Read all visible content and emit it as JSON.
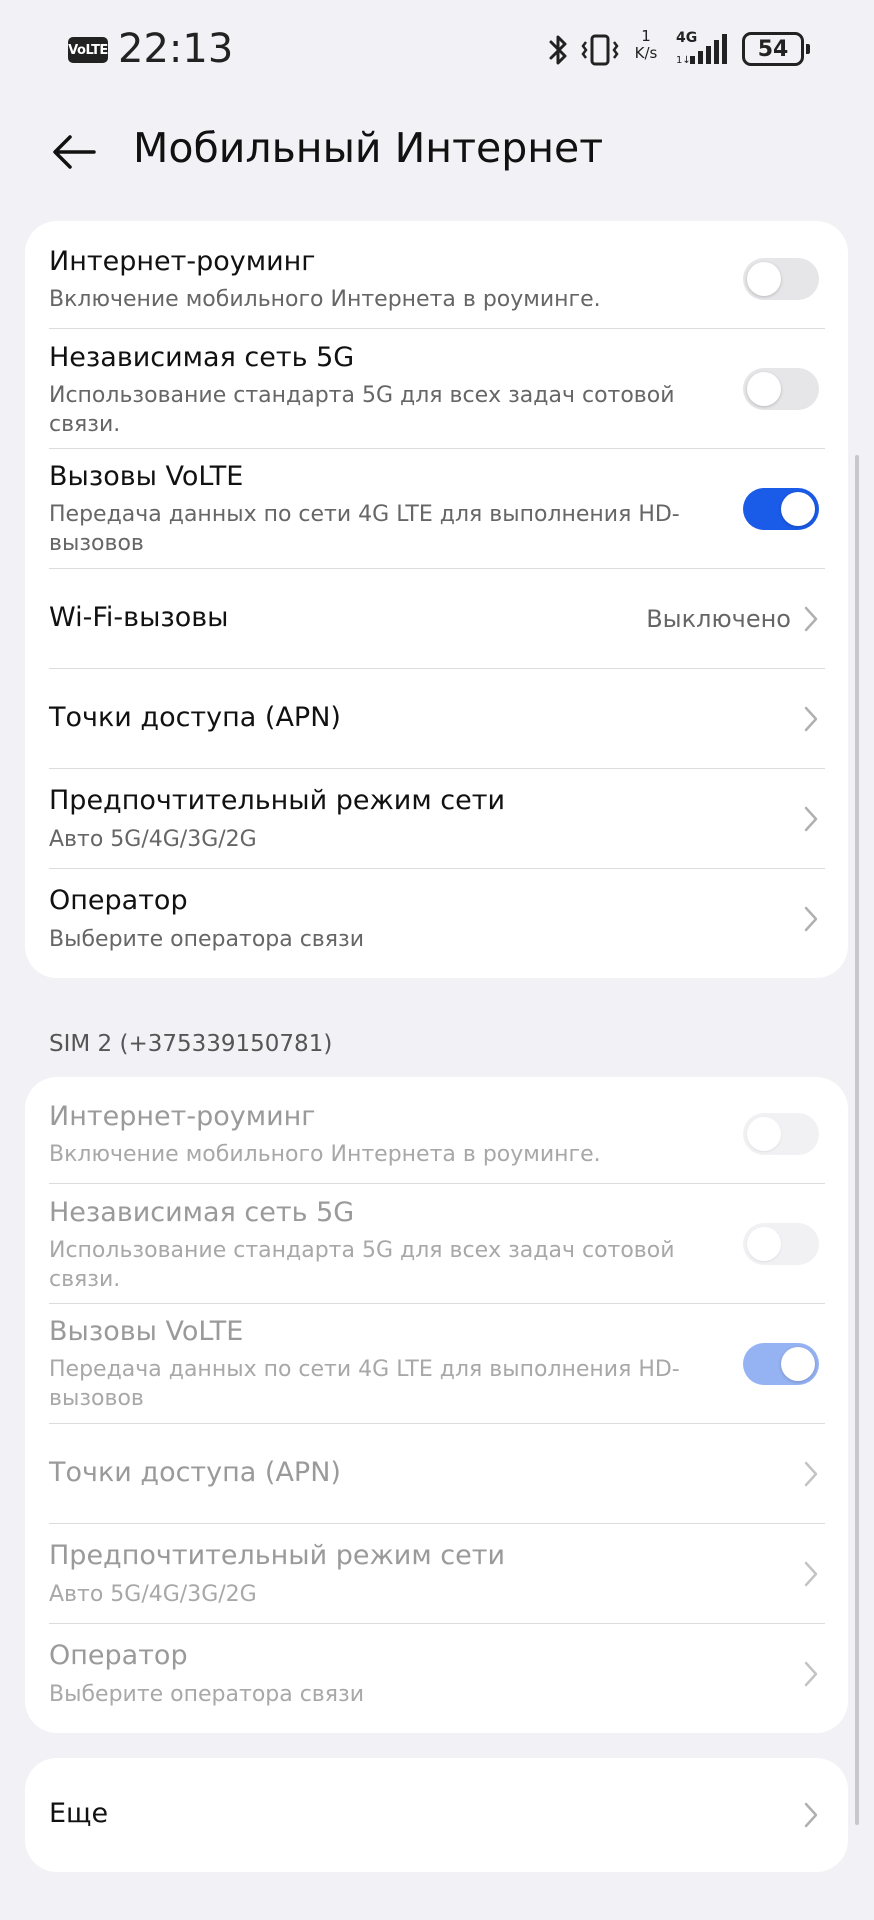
{
  "status_bar": {
    "volte": "VoLTE",
    "time": "22:13",
    "speed_value": "1",
    "speed_unit": "K/s",
    "network": "4G",
    "battery": "54"
  },
  "header": {
    "title": "Мобильный Интернет"
  },
  "sim1": {
    "roaming": {
      "title": "Интернет-роуминг",
      "subtitle": "Включение мобильного Интернета в роуминге."
    },
    "sa5g": {
      "title": "Независимая сеть 5G",
      "subtitle": "Использование стандарта 5G для всех задач сотовой связи."
    },
    "volte": {
      "title": "Вызовы VoLTE",
      "subtitle": "Передача данных по сети 4G LTE для выполнения HD-вызовов"
    },
    "wifi_calls": {
      "title": "Wi-Fi-вызовы",
      "value": "Выключено"
    },
    "apn": {
      "title": "Точки доступа (APN)"
    },
    "network_mode": {
      "title": "Предпочтительный режим сети",
      "subtitle": "Авто 5G/4G/3G/2G"
    },
    "operator": {
      "title": "Оператор",
      "subtitle": "Выберите оператора связи"
    }
  },
  "sim2": {
    "header": "SIM 2 (+375339150781)",
    "roaming": {
      "title": "Интернет-роуминг",
      "subtitle": "Включение мобильного Интернета в роуминге."
    },
    "sa5g": {
      "title": "Независимая сеть 5G",
      "subtitle": "Использование стандарта 5G для всех задач сотовой связи."
    },
    "volte": {
      "title": "Вызовы VoLTE",
      "subtitle": "Передача данных по сети 4G LTE для выполнения HD-вызовов"
    },
    "apn": {
      "title": "Точки доступа (APN)"
    },
    "network_mode": {
      "title": "Предпочтительный режим сети",
      "subtitle": "Авто 5G/4G/3G/2G"
    },
    "operator": {
      "title": "Оператор",
      "subtitle": "Выберите оператора связи"
    }
  },
  "more": {
    "title": "Еще"
  },
  "toggles": {
    "sim1_roaming": false,
    "sim1_sa5g": false,
    "sim1_volte": true,
    "sim2_roaming": false,
    "sim2_sa5g": false,
    "sim2_volte": true
  },
  "colors": {
    "accent": "#1a5be8",
    "accent_disabled": "#95b2f2",
    "background": "#f2f2f6"
  },
  "icons": {
    "back": "arrow-left-icon",
    "chevron": "chevron-right-icon",
    "bluetooth": "bluetooth-icon",
    "vibrate": "vibrate-icon",
    "signal": "signal-icon"
  }
}
